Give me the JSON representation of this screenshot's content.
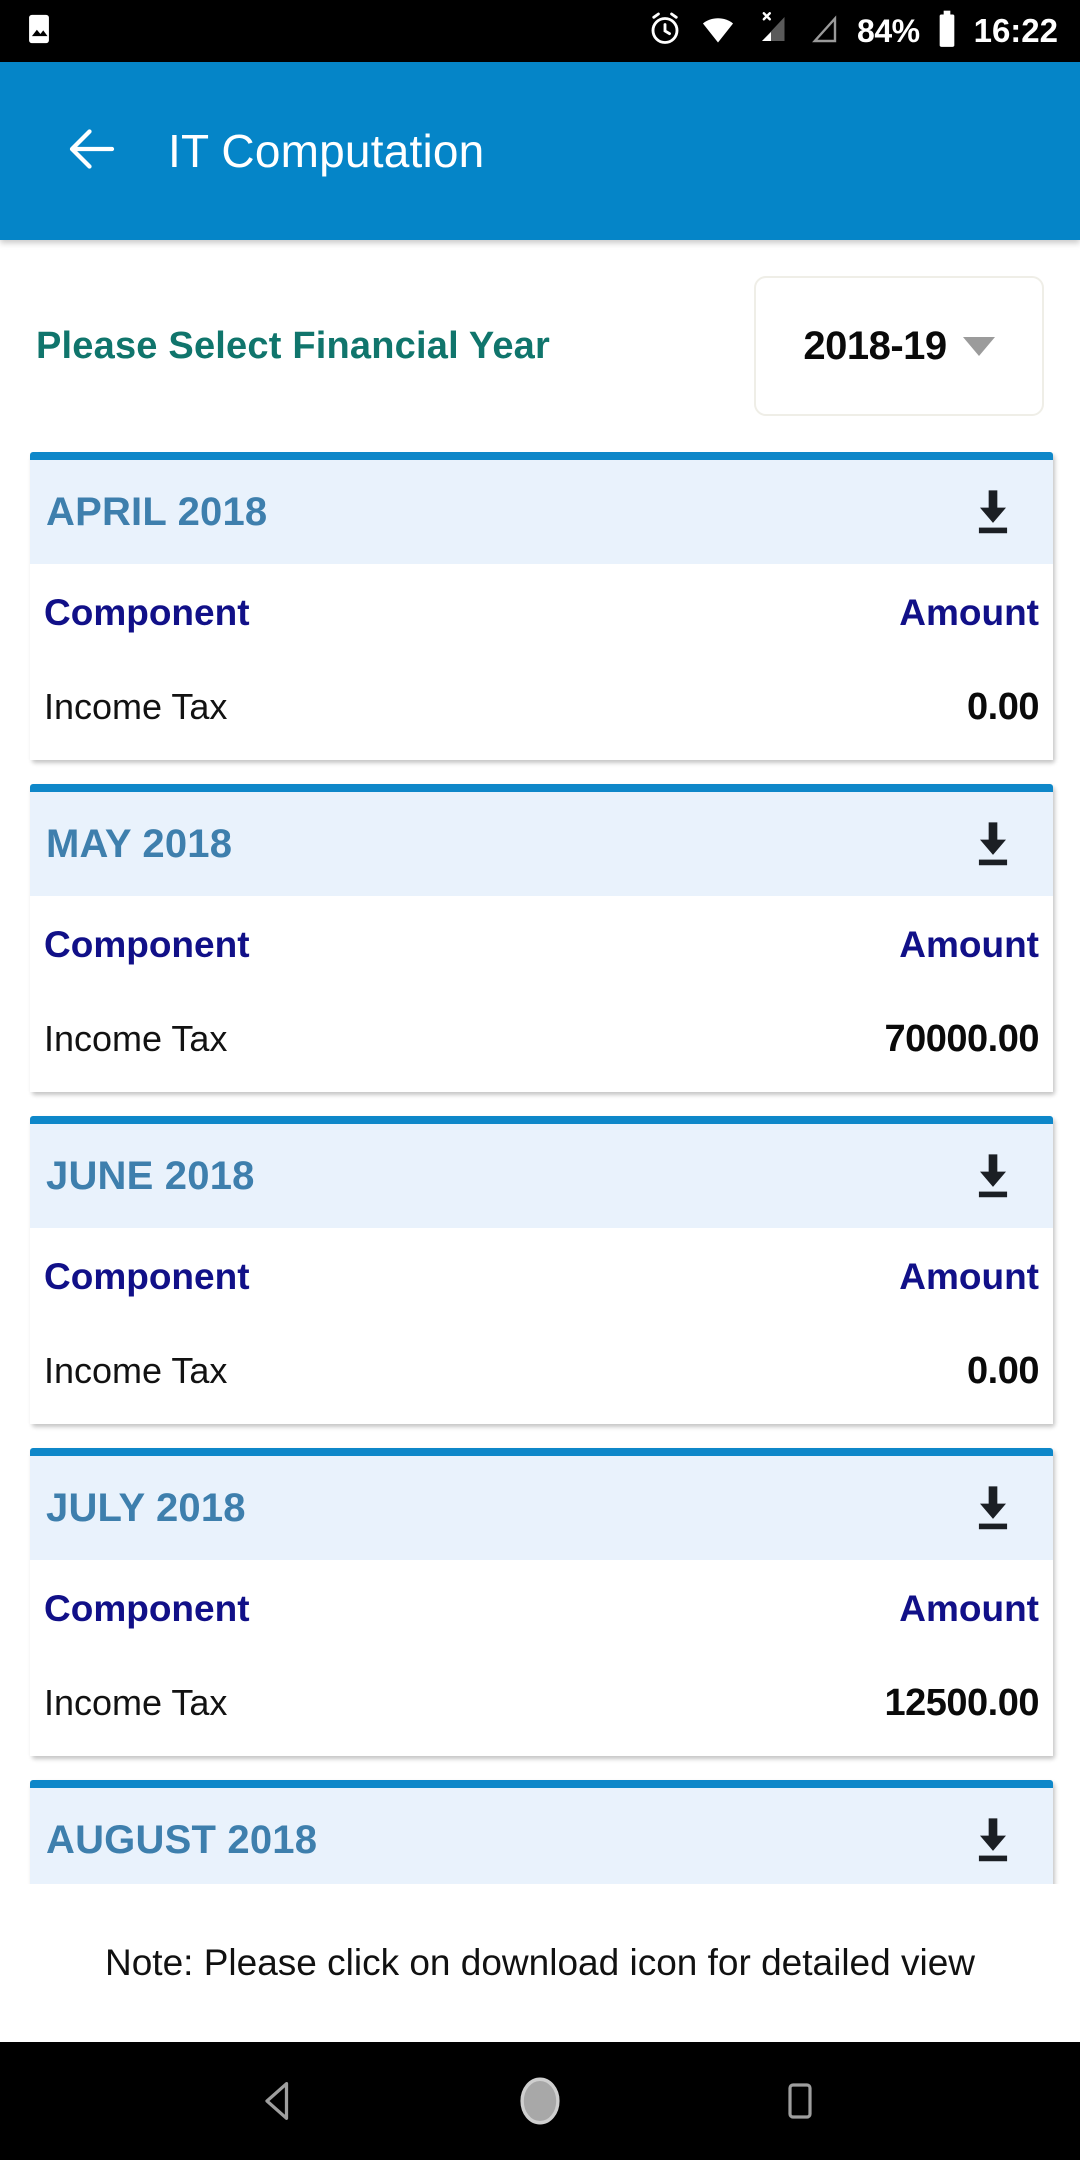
{
  "status_bar": {
    "icons": [
      "image-icon",
      "alarm-icon",
      "wifi-icon",
      "signal-off-icon",
      "signal-empty-icon"
    ],
    "battery_percent": "84%",
    "battery_icon": "battery-icon",
    "clock": "16:22"
  },
  "app_bar": {
    "back_icon": "arrow-left-icon",
    "title": "IT Computation",
    "background_color": "#0585c8"
  },
  "financial_year": {
    "label": "Please Select Financial Year",
    "label_color": "#10756c",
    "selected": "2018-19",
    "caret_icon": "chevron-down-icon"
  },
  "table_headers": {
    "component": "Component",
    "amount": "Amount"
  },
  "cards": [
    {
      "month": "APRIL 2018",
      "download_icon": "download-icon",
      "rows": [
        {
          "component": "Income Tax",
          "amount": "0.00"
        }
      ]
    },
    {
      "month": "MAY 2018",
      "download_icon": "download-icon",
      "rows": [
        {
          "component": "Income Tax",
          "amount": "70000.00"
        }
      ]
    },
    {
      "month": "JUNE 2018",
      "download_icon": "download-icon",
      "rows": [
        {
          "component": "Income Tax",
          "amount": "0.00"
        }
      ]
    },
    {
      "month": "JULY 2018",
      "download_icon": "download-icon",
      "rows": [
        {
          "component": "Income Tax",
          "amount": "12500.00"
        }
      ]
    },
    {
      "month": "AUGUST 2018",
      "download_icon": "download-icon",
      "rows": []
    }
  ],
  "note": "Note: Please click on download icon for detailed view",
  "nav_bar": {
    "back": "nav-back-icon",
    "home": "nav-home-icon",
    "recents": "nav-recents-icon"
  },
  "colors": {
    "accent_blue": "#0e87c9",
    "card_header_bg": "#e9f2fc",
    "month_title": "#3e7fad",
    "table_header": "#111088",
    "teal_label": "#10756c"
  }
}
